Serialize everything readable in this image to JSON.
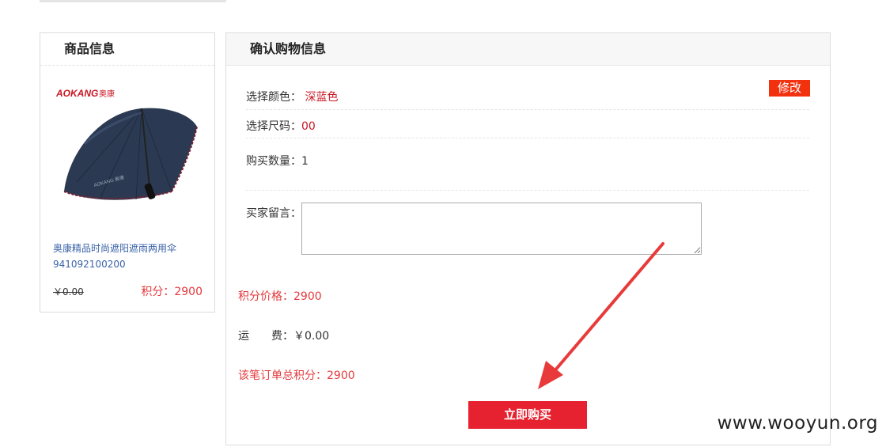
{
  "product_panel": {
    "title": "商品信息",
    "brand_logo_text": "AOKANG 奥康",
    "name": "奥康精品时尚遮阳遮雨两用伞941092100200",
    "price": "￥0.00",
    "points": "积分：2900"
  },
  "confirm_panel": {
    "title": "确认购物信息",
    "color_label": "选择颜色：",
    "color_value": "深蓝色",
    "size_label": "选择尺码：",
    "size_value": "00",
    "edit_label": "修改",
    "quantity_label": "购买数量：",
    "quantity_value": "1",
    "remark_label": "买家留言：",
    "remark_value": "",
    "points_price": "积分价格：2900",
    "shipping_label_a": "运",
    "shipping_label_b": "费：",
    "shipping_value": "￥0.00",
    "total_points": "该笔订单总积分：2900",
    "buy_label": "立即购买"
  },
  "watermark": "www.wooyun.org",
  "colors": {
    "accent_red": "#e62230",
    "edit_orange": "#f2320f",
    "link_blue": "#3a62a8"
  }
}
